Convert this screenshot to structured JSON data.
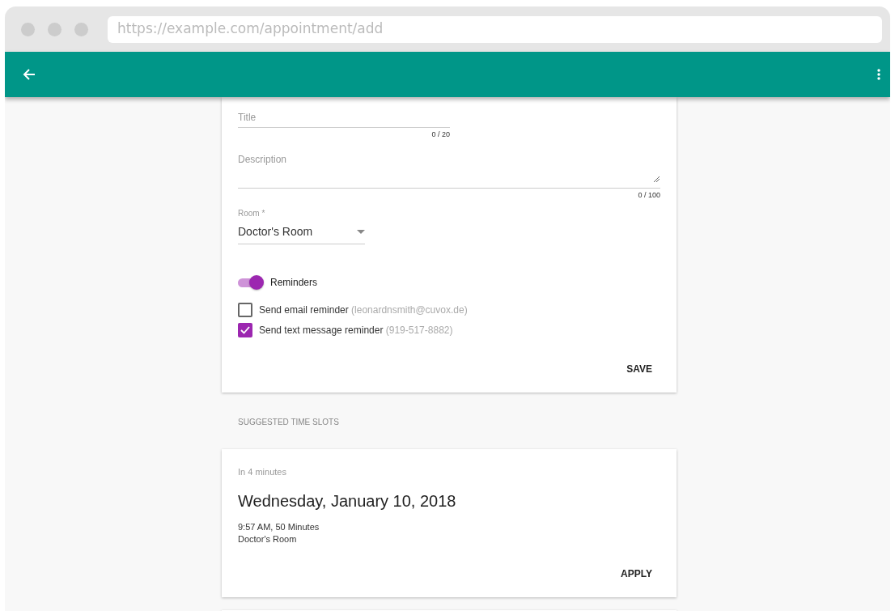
{
  "browser": {
    "url": "https://example.com/appointment/add"
  },
  "form": {
    "fields": [
      {
        "kind": "text",
        "placeholder": "Title",
        "counter": "0 / 20"
      },
      {
        "kind": "textarea",
        "placeholder": "Description",
        "counter": "0 / 100"
      }
    ],
    "room": {
      "label": "Room *",
      "value": "Doctor's Room"
    },
    "reminders": {
      "label": "Reminders",
      "on": true
    },
    "options": [
      {
        "label": "Send email reminder",
        "detail": "(leonardnsmith@cuvox.de)",
        "checked": false
      },
      {
        "label": "Send text message reminder",
        "detail": "(919-517-8882)",
        "checked": true
      }
    ],
    "save": "SAVE"
  },
  "section_label": "SUGGESTED TIME SLOTS",
  "slots": [
    {
      "relative": "In 4 minutes",
      "date": "Wednesday, January 10, 2018",
      "time": "9:57 AM, 50 Minutes",
      "room": "Doctor's Room",
      "action": "APPLY"
    }
  ]
}
